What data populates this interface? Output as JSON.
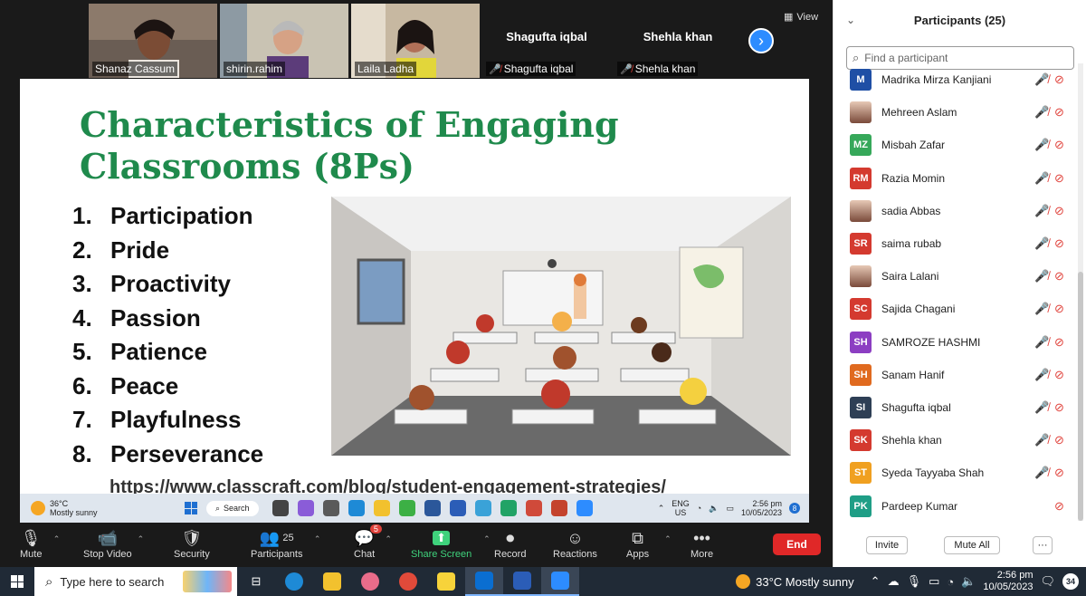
{
  "video_strip": {
    "tiles": [
      {
        "name": "Shanaz Cassum"
      },
      {
        "name": "shirin.rahim"
      },
      {
        "name": "Laila Ladha"
      }
    ],
    "text_tiles": [
      {
        "display": "Shagufta iqbal",
        "tag": "Shagufta iqbal"
      },
      {
        "display": "Shehla khan",
        "tag": "Shehla khan"
      }
    ],
    "view_label": "View"
  },
  "slide": {
    "title": "Characteristics of Engaging Classrooms (8Ps)",
    "items": [
      {
        "num": "1.",
        "text": "Participation"
      },
      {
        "num": "2.",
        "text": "Pride"
      },
      {
        "num": "3.",
        "text": "Proactivity"
      },
      {
        "num": "4.",
        "text": "Passion"
      },
      {
        "num": "5.",
        "text": "Patience"
      },
      {
        "num": "6.",
        "text": "Peace"
      },
      {
        "num": "7.",
        "text": "Playfulness"
      },
      {
        "num": "8.",
        "text": "Perseverance"
      }
    ],
    "url": "https://www.classcraft.com/blog/student-engagement-strategies/"
  },
  "inner_taskbar": {
    "temp": "36°C",
    "condition": "Mostly sunny",
    "search": "Search",
    "lang_top": "ENG",
    "lang_bottom": "US",
    "time": "2:56 pm",
    "date": "10/05/2023",
    "notif": "8"
  },
  "toolbar": {
    "mute": "Mute",
    "stop_video": "Stop Video",
    "security": "Security",
    "participants": "Participants",
    "participants_count": "25",
    "chat": "Chat",
    "chat_badge": "5",
    "share_screen": "Share Screen",
    "record": "Record",
    "reactions": "Reactions",
    "apps": "Apps",
    "more": "More",
    "end": "End"
  },
  "panel": {
    "title": "Participants (25)",
    "search_placeholder": "Find a participant",
    "invite": "Invite",
    "mute_all": "Mute All",
    "more_dots": "···",
    "participants": [
      {
        "initials": "M",
        "name": "Madrika Mirza Kanjiani",
        "color": "#1f4fa5"
      },
      {
        "initials": "",
        "name": "Mehreen Aslam",
        "color": "photo"
      },
      {
        "initials": "MZ",
        "name": "Misbah Zafar",
        "color": "#36a85a"
      },
      {
        "initials": "RM",
        "name": "Razia  Momin",
        "color": "#d43a2f"
      },
      {
        "initials": "",
        "name": "sadia Abbas",
        "color": "photo"
      },
      {
        "initials": "SR",
        "name": "saima rubab",
        "color": "#d43a2f"
      },
      {
        "initials": "",
        "name": "Saira Lalani",
        "color": "photo"
      },
      {
        "initials": "SC",
        "name": "Sajida Chagani",
        "color": "#d43a2f"
      },
      {
        "initials": "SH",
        "name": "SAMROZE HASHMI",
        "color": "#8c3ec2"
      },
      {
        "initials": "SH",
        "name": "Sanam Hanif",
        "color": "#e06a1f"
      },
      {
        "initials": "SI",
        "name": "Shagufta iqbal",
        "color": "#2e3f55"
      },
      {
        "initials": "SK",
        "name": "Shehla khan",
        "color": "#d43a2f"
      },
      {
        "initials": "ST",
        "name": "Syeda Tayyaba Shah",
        "color": "#f0a020"
      },
      {
        "initials": "PK",
        "name": "Pardeep Kumar",
        "color": "#1f9e86"
      }
    ]
  },
  "taskbar": {
    "search_placeholder": "Type here to search",
    "weather": "33°C  Mostly sunny",
    "time": "2:56 pm",
    "date": "10/05/2023",
    "notif": "34"
  }
}
